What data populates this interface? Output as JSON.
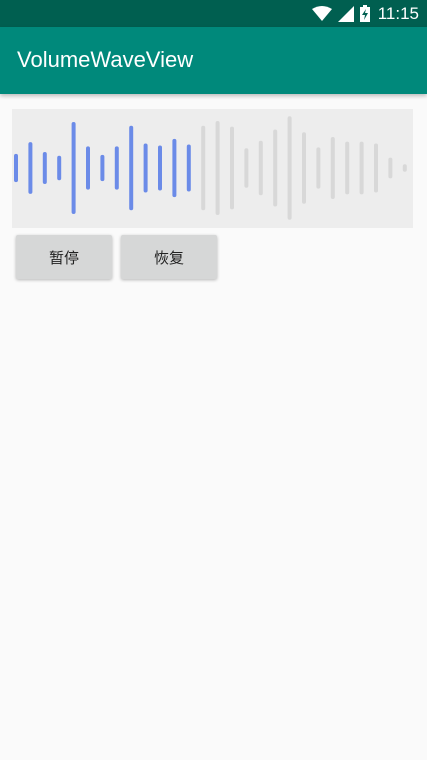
{
  "status_bar": {
    "time": "11:15",
    "icons": [
      "wifi-icon",
      "signal-icon",
      "battery-charging-icon"
    ]
  },
  "app_bar": {
    "title": "VolumeWaveView"
  },
  "wave_view": {
    "active_color": "#6b8be8",
    "inactive_color": "#d8d8d8",
    "background": "#ededed",
    "bars": [
      {
        "level": 0.3,
        "active": true
      },
      {
        "level": 0.55,
        "active": true
      },
      {
        "level": 0.34,
        "active": true
      },
      {
        "level": 0.26,
        "active": true
      },
      {
        "level": 0.98,
        "active": true
      },
      {
        "level": 0.46,
        "active": true
      },
      {
        "level": 0.28,
        "active": true
      },
      {
        "level": 0.46,
        "active": true
      },
      {
        "level": 0.9,
        "active": true
      },
      {
        "level": 0.52,
        "active": true
      },
      {
        "level": 0.48,
        "active": true
      },
      {
        "level": 0.62,
        "active": true
      },
      {
        "level": 0.5,
        "active": true
      },
      {
        "level": 0.9,
        "active": false
      },
      {
        "level": 1.0,
        "active": false
      },
      {
        "level": 0.88,
        "active": false
      },
      {
        "level": 0.42,
        "active": false
      },
      {
        "level": 0.58,
        "active": false
      },
      {
        "level": 0.82,
        "active": false
      },
      {
        "level": 1.1,
        "active": false
      },
      {
        "level": 0.76,
        "active": false
      },
      {
        "level": 0.44,
        "active": false
      },
      {
        "level": 0.66,
        "active": false
      },
      {
        "level": 0.56,
        "active": false
      },
      {
        "level": 0.56,
        "active": false
      },
      {
        "level": 0.52,
        "active": false
      },
      {
        "level": 0.22,
        "active": false
      },
      {
        "level": 0.08,
        "active": false
      }
    ]
  },
  "buttons": {
    "pause_label": "暂停",
    "resume_label": "恢复"
  }
}
